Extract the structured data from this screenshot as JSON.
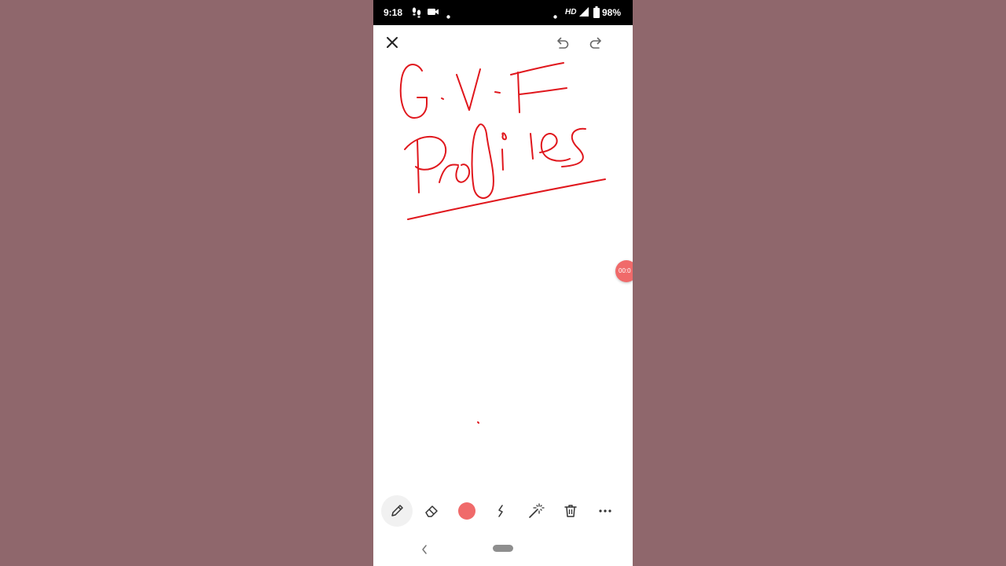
{
  "status_bar": {
    "time": "9:18",
    "network_label": "HD",
    "battery": "98%"
  },
  "header": {
    "close_icon": "close-icon",
    "undo_icon": "undo-icon",
    "redo_icon": "redo-icon"
  },
  "canvas": {
    "handwritten_title": "G.V.F Profiles",
    "ink_color": "#e0171d"
  },
  "recording_timer": "00:0",
  "toolbar": {
    "tools": [
      "pen-icon",
      "eraser-icon",
      "color-swatch",
      "stroke-icon",
      "magic-wand-icon",
      "trash-icon",
      "more-icon"
    ],
    "active_tool": "pen-icon",
    "selected_color": "#f06a6a"
  },
  "nav": {
    "back_icon": "back-icon",
    "home_icon": "home-pill"
  }
}
